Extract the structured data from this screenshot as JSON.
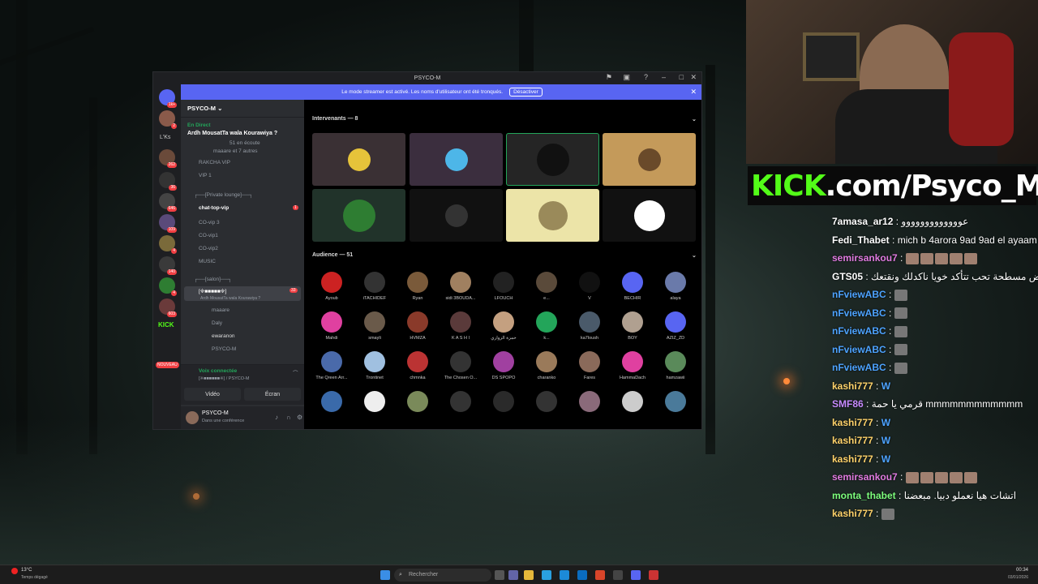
{
  "window": {
    "title": "PSYCO-M"
  },
  "banner": {
    "text": "Le mode streamer est activé. Les noms d'utilisateur ont été tronqués.",
    "button": "Désactiver"
  },
  "guilds": {
    "labels": [
      "L'Ks",
      "KICK",
      "NOUVEAU"
    ],
    "badges": [
      "1k+",
      "2",
      "262",
      "36",
      "646",
      "109",
      "4",
      "140",
      "4",
      "603",
      "3"
    ]
  },
  "sidebar": {
    "server_name": "PSYCO-M",
    "live_label": "En Direct",
    "stage_title": "Ardh MousatTa wala Kourawiya ?",
    "stage_sub": "51 en écoute",
    "stage_speakers": "maaare et 7 autres",
    "channels": [
      "RAKCHA VIP",
      "VIP 1",
      "┌──[Private lounge]──┐",
      "chat-top-vip",
      "CO-vip 3",
      "CO-vip1",
      "CO-vip2",
      "MUSIC",
      "┌──[salon]──┐",
      "[※■■■■■※]",
      "Ardh MousatTa wala Kourawiya ?",
      "maaare",
      "Daly",
      "ewaranon",
      "PSYCO-M"
    ],
    "unread": "1",
    "stage_count": "33"
  },
  "voice_panel": {
    "status": "Voix connectée",
    "channel": "[※■■■■■■※] / PSYCO-M",
    "video_btn": "Vidéo",
    "screen_btn": "Écran"
  },
  "user_panel": {
    "name": "PSYCO-M",
    "status": "Dans une conférence"
  },
  "stage": {
    "speakers_header": "Intervenants — 8",
    "audience_header": "Audience — 51",
    "audience": [
      "Ayoub",
      "iTACHIDEF",
      "Ryan",
      "sidi 3BOUDA...",
      "LFOUCH",
      "e...",
      "V",
      "BECHIR",
      "alaya",
      "Mahdi",
      "smayli",
      "HVMZA",
      "K A S H I",
      "حمزة الزواري",
      "k...",
      "ka7loush",
      "BOY",
      "AZIZ_ZD",
      "The Qreen Arr...",
      "Trontinet",
      "chmnka",
      "The Chosen O...",
      "DS SPOPO",
      "charanko",
      "Fares",
      "HammaDach",
      "hamzawii"
    ]
  },
  "overlay": {
    "kick_brand": "KICK",
    "kick_url": ".com/Psyco_M"
  },
  "chat": [
    {
      "user": "7amasa_ar12",
      "color": "#ffffff",
      "text": "عووووووووووووو"
    },
    {
      "user": "Fedi_Thabet",
      "color": "#ffffff",
      "text": "mich b 4arora 9ad 9ad el ayaam"
    },
    {
      "user": "semirsankou7",
      "color": "#e07be0",
      "text": ""
    },
    {
      "user": "GTS05",
      "color": "#ffffff",
      "text": "يا حمة الارض مسطحة تحب تتأكد خويا ناكدلك ونقتعك"
    },
    {
      "user": "nFviewABC",
      "color": "#4da3ff",
      "text": ""
    },
    {
      "user": "nFviewABC",
      "color": "#4da3ff",
      "text": ""
    },
    {
      "user": "nFviewABC",
      "color": "#4da3ff",
      "text": ""
    },
    {
      "user": "nFviewABC",
      "color": "#4da3ff",
      "text": ""
    },
    {
      "user": "nFviewABC",
      "color": "#4da3ff",
      "text": ""
    },
    {
      "user": "kashi777",
      "color": "#ffd36b",
      "text": "W"
    },
    {
      "user": "SMF86",
      "color": "#c78bff",
      "text": "قرمي يا حمة mmmmmmmmmmmm"
    },
    {
      "user": "kashi777",
      "color": "#ffd36b",
      "text": "W"
    },
    {
      "user": "kashi777",
      "color": "#ffd36b",
      "text": "W"
    },
    {
      "user": "kashi777",
      "color": "#ffd36b",
      "text": "W"
    },
    {
      "user": "semirsankou7",
      "color": "#e07be0",
      "text": ""
    },
    {
      "user": "monta_thabet",
      "color": "#7dff7d",
      "text": "اتشات هيا نعملو دبيا. مبعضنا"
    },
    {
      "user": "kashi777",
      "color": "#ffd36b",
      "text": ""
    }
  ],
  "taskbar": {
    "weather": "13°C",
    "weather_desc": "Temps dégagé",
    "search": "Rechercher",
    "time": "00:34",
    "date": "03/01/2026"
  }
}
